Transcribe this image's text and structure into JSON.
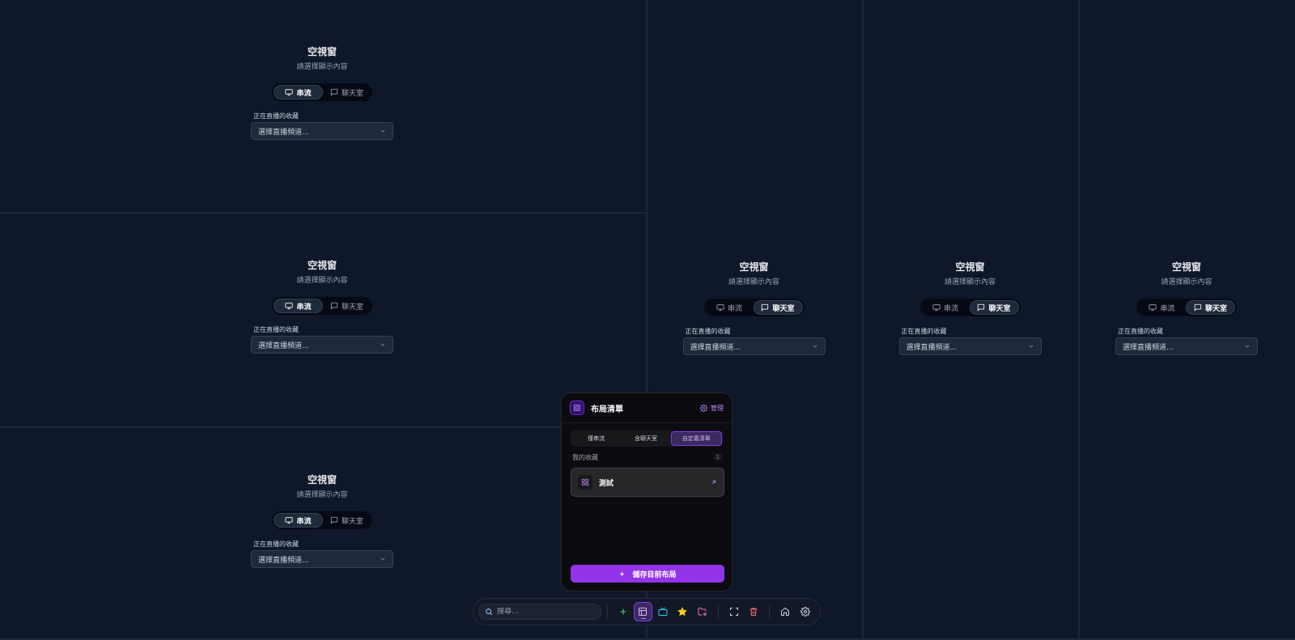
{
  "panes": [
    {
      "title": "空視窗",
      "subtitle": "請選擇顯示內容",
      "tab_stream": "串流",
      "tab_chat": "聊天室",
      "active": "stream",
      "fav_label": "正在直播的收藏",
      "select_placeholder": "選擇直播頻道..."
    },
    {
      "title": "空視窗",
      "subtitle": "請選擇顯示內容",
      "tab_stream": "串流",
      "tab_chat": "聊天室",
      "active": "stream",
      "fav_label": "正在直播的收藏",
      "select_placeholder": "選擇直播頻道..."
    },
    {
      "title": "空視窗",
      "subtitle": "請選擇顯示內容",
      "tab_stream": "串流",
      "tab_chat": "聊天室",
      "active": "stream",
      "fav_label": "正在直播的收藏",
      "select_placeholder": "選擇直播頻道..."
    },
    {
      "title": "空視窗",
      "subtitle": "請選擇顯示內容",
      "tab_stream": "串流",
      "tab_chat": "聊天室",
      "active": "chat",
      "fav_label": "正在直播的收藏",
      "select_placeholder": "選擇直播頻道..."
    },
    {
      "title": "空視窗",
      "subtitle": "請選擇顯示內容",
      "tab_stream": "串流",
      "tab_chat": "聊天室",
      "active": "chat",
      "fav_label": "正在直播的收藏",
      "select_placeholder": "選擇直播頻道..."
    },
    {
      "title": "空視窗",
      "subtitle": "請選擇顯示內容",
      "tab_stream": "串流",
      "tab_chat": "聊天室",
      "active": "chat",
      "fav_label": "正在直播的收藏",
      "select_placeholder": "選擇直播頻道..."
    }
  ],
  "layout_popover": {
    "title": "布局清單",
    "manage_label": "管理",
    "tabs": [
      "僅串流",
      "含聊天室",
      "自定義清單"
    ],
    "active_tab": "自定義清單",
    "section_label": "我的收藏",
    "section_count": "1",
    "items": [
      {
        "name": "測試",
        "icon": "grid-icon"
      }
    ],
    "save_label": "儲存目前布局"
  },
  "toolbar": {
    "search_placeholder": "搜尋...",
    "buttons": [
      "add-icon",
      "layout-icon",
      "tv-icon",
      "star-icon",
      "folder-heart-icon",
      "fullscreen-icon",
      "trash-icon",
      "home-icon",
      "gear-icon"
    ],
    "active_button": "layout-icon"
  },
  "colors": {
    "background": "#0f172a",
    "accent": "#9333ea",
    "accent_light": "#c084fc",
    "add": "#4ade80",
    "tv": "#22d3ee",
    "star": "#facc15",
    "folder": "#f472b6",
    "trash": "#f87171"
  }
}
